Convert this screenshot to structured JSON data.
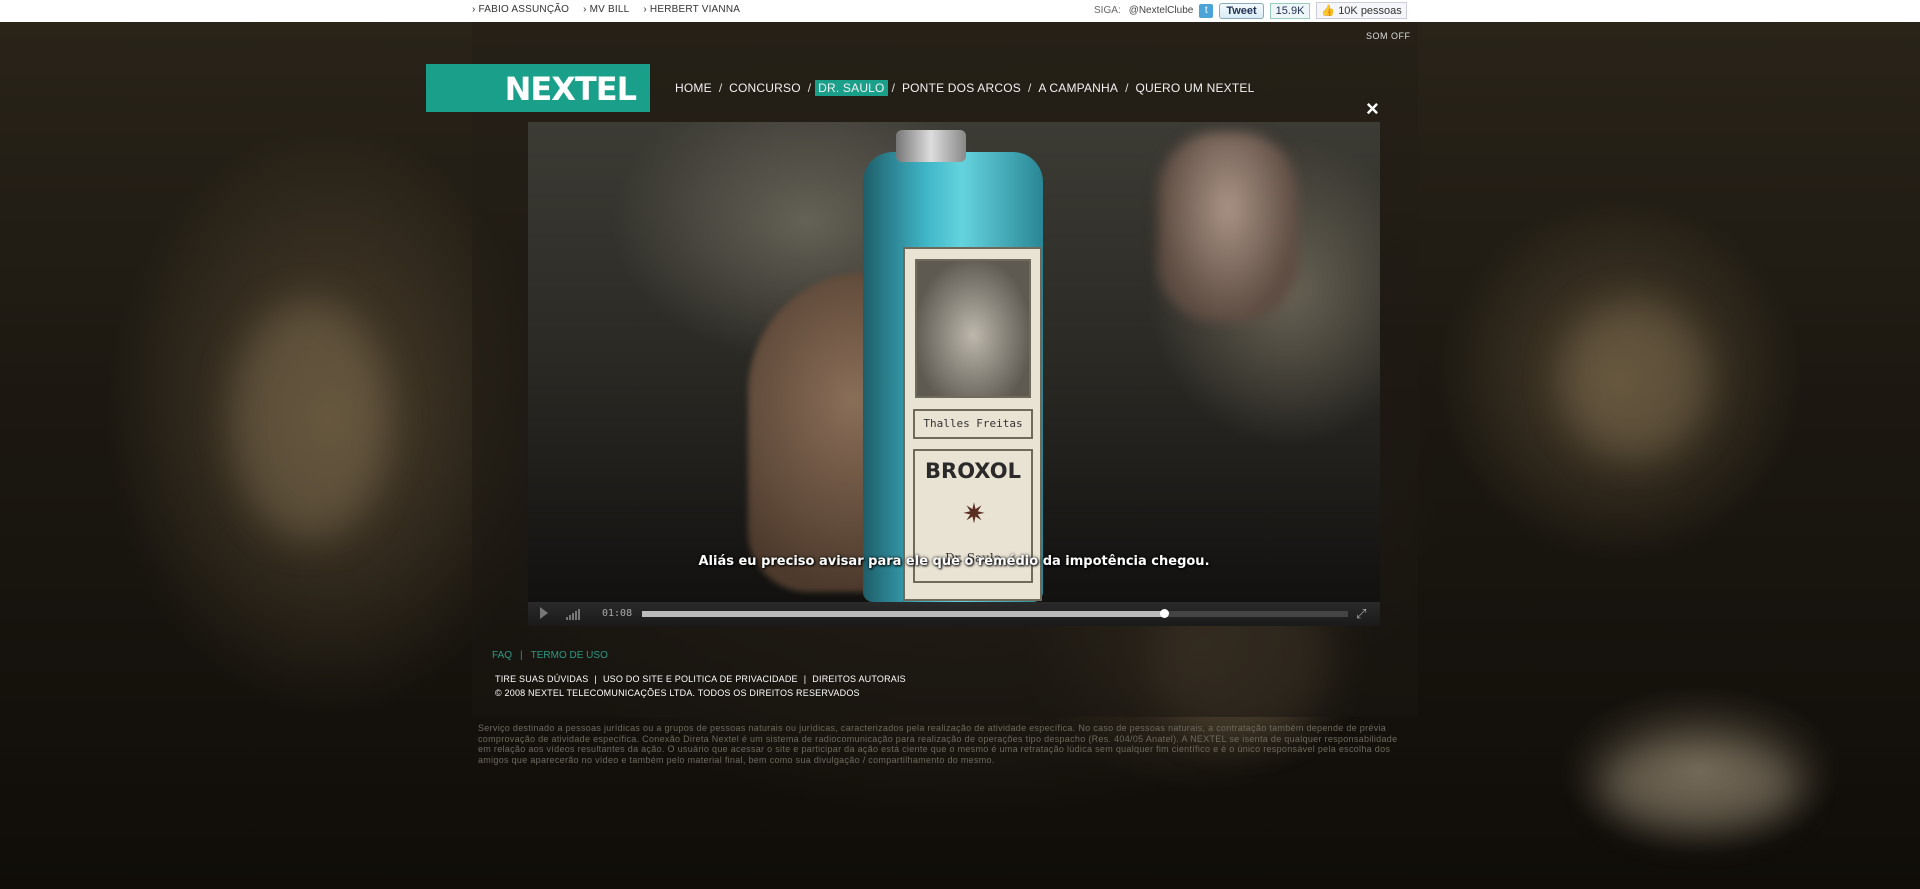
{
  "topbar": {
    "links": [
      "› FABIO ASSUNÇÃO",
      "› MV BILL",
      "› HERBERT VIANNA"
    ],
    "siga_label": "SIGA:",
    "twitter_handle": "@NextelClube",
    "tweet_label": "Tweet",
    "tweet_count": "15.9K",
    "like_label": "10K pessoas"
  },
  "header": {
    "sound_toggle": "SOM OFF",
    "logo_text": "NEXTEL",
    "nav": [
      "HOME",
      "CONCURSO",
      "DR. SAULO",
      "PONTE DOS ARCOS",
      "A CAMPANHA",
      "QUERO UM NEXTEL"
    ],
    "nav_active": "DR. SAULO",
    "close_label": "×"
  },
  "video": {
    "subtitle": "Aliás eu preciso avisar para ele que o remédio da impotência chegou.",
    "label_name": "Thalles Freitas",
    "label_brand": "BROXOL",
    "label_doctor": "Dr. Saulo",
    "time": "01:08",
    "progress": 0.74
  },
  "footer": {
    "faq": "FAQ",
    "terms": "TERMO DE USO",
    "links": [
      "TIRE SUAS DÚVIDAS",
      "USO DO SITE E POLITICA DE PRIVACIDADE",
      "DIREITOS AUTORAIS"
    ],
    "copyright": "© 2008 NEXTEL TELECOMUNICAÇÕES LTDA. TODOS OS DIREITOS RESERVADOS",
    "disclaimer": "Serviço destinado a pessoas jurídicas ou a grupos de pessoas naturais ou jurídicas, caracterizados pela realização de atividade específica. No caso de pessoas naturais, a contratação também depende de prévia comprovação de atividade específica. Conexão Direta Nextel é um sistema de radiocomunicação para realização de operações tipo despacho (Res. 404/05 Anatel). A NEXTEL se isenta de qualquer responsabilidade em relação aos vídeos resultantes da ação. O usuário que acessar o site e participar da ação está ciente que o mesmo é uma retratação lúdica sem qualquer fim científico e é o único responsável pela escolha dos amigos que aparecerão no vídeo e também pelo material final, bem como sua divulgação / compartilhamento do mesmo."
  },
  "colors": {
    "brand": "#1aa08a"
  }
}
